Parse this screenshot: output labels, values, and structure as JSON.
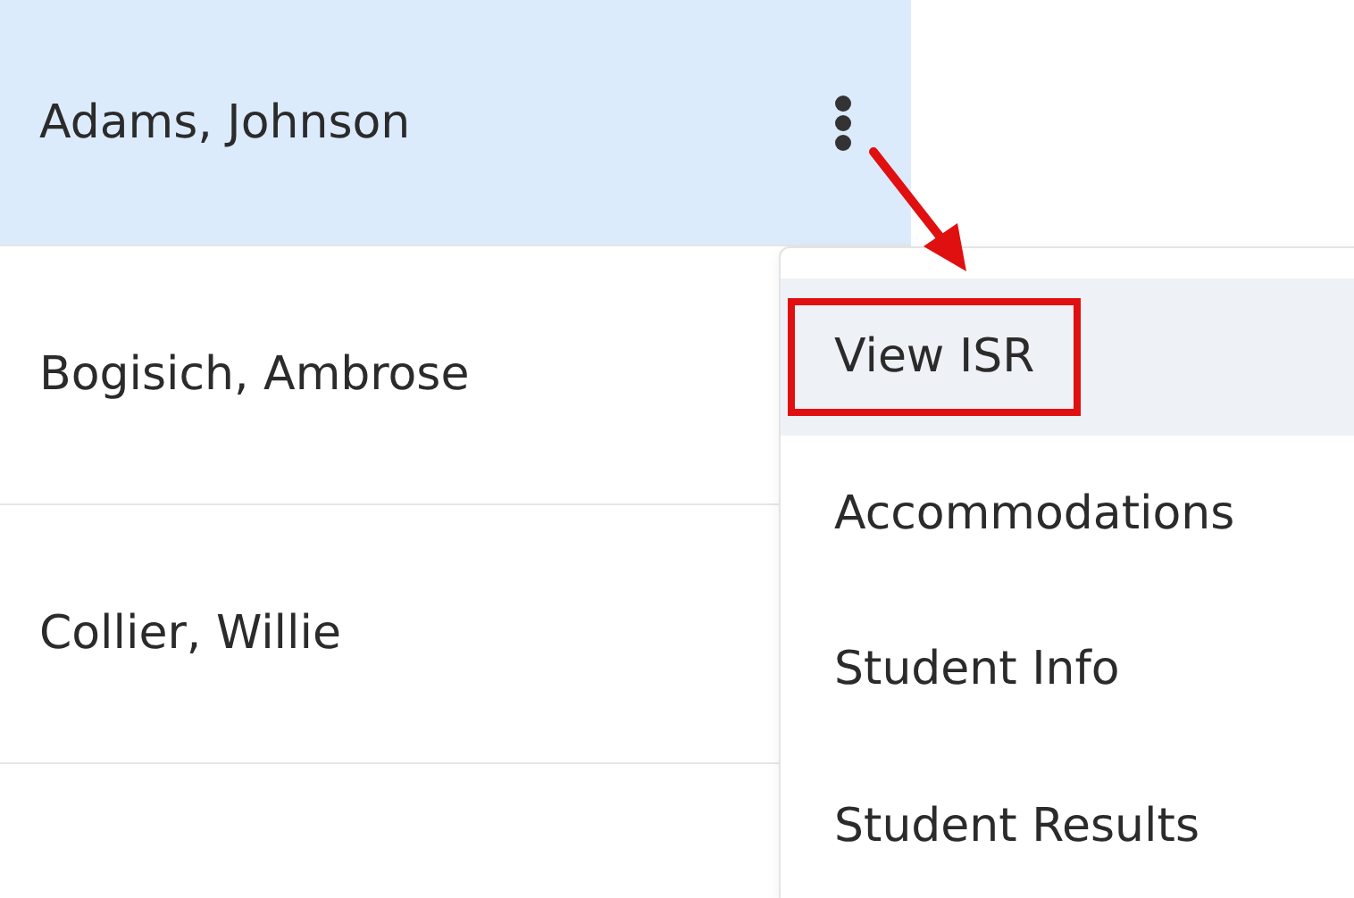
{
  "students": [
    {
      "name": "Adams, Johnson",
      "selected": true
    },
    {
      "name": "Bogisich, Ambrose",
      "selected": false
    },
    {
      "name": "Collier, Willie",
      "selected": false
    }
  ],
  "menu": {
    "items": [
      {
        "label": "View ISR",
        "selected": true,
        "annotated": true
      },
      {
        "label": "Accommodations",
        "selected": false,
        "annotated": false
      },
      {
        "label": "Student Info",
        "selected": false,
        "annotated": false
      },
      {
        "label": "Student Results",
        "selected": false,
        "annotated": false
      }
    ]
  }
}
